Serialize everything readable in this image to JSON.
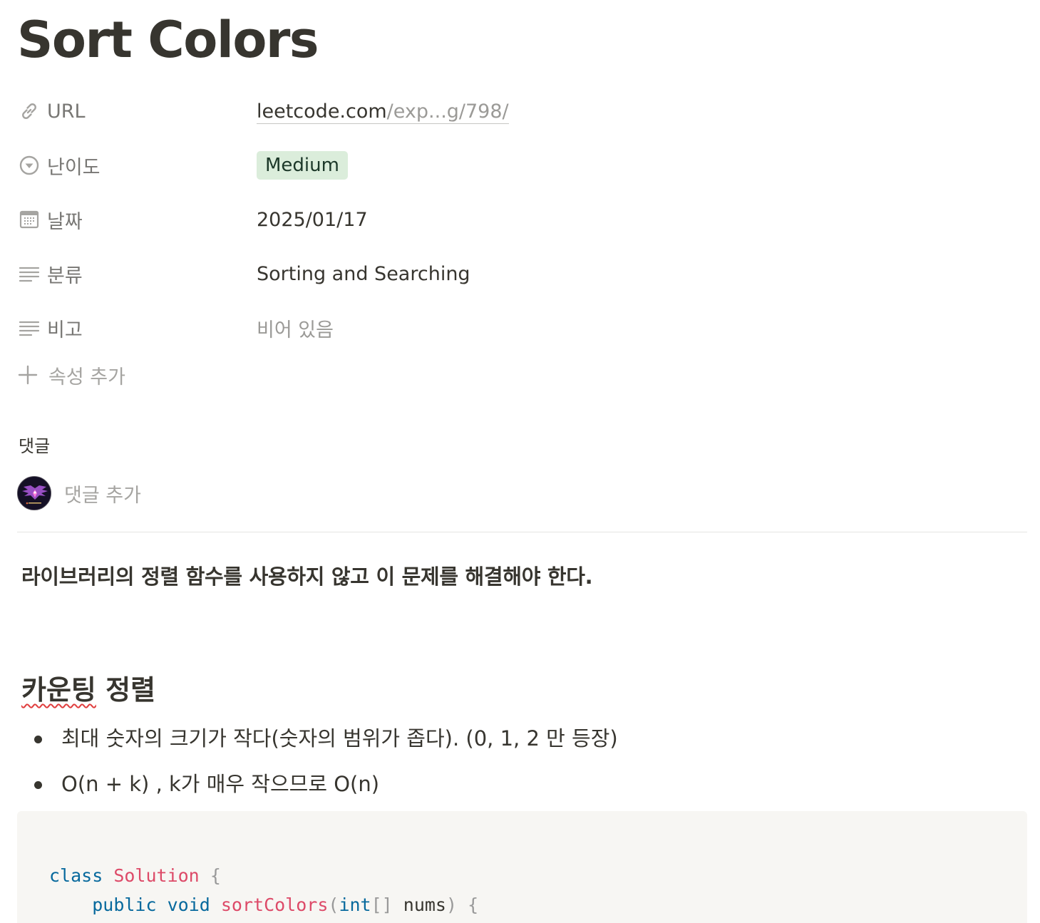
{
  "page": {
    "title": "Sort Colors"
  },
  "properties": {
    "url": {
      "label": "URL",
      "icon": "link-icon",
      "value_main": "leetcode.com",
      "value_rest": "/exp...g/798/"
    },
    "difficulty": {
      "label": "난이도",
      "icon": "select-icon",
      "value": "Medium",
      "color": "#dbeddb"
    },
    "date": {
      "label": "날짜",
      "icon": "calendar-icon",
      "value": "2025/01/17"
    },
    "category": {
      "label": "분류",
      "icon": "text-icon",
      "value": "Sorting and Searching"
    },
    "note": {
      "label": "비고",
      "icon": "text-icon",
      "value": "비어 있음"
    },
    "add_property": "속성 추가"
  },
  "comments": {
    "heading": "댓글",
    "placeholder": "댓글 추가"
  },
  "content": {
    "bold_paragraph": "라이브러리의 정렬 함수를 사용하지 않고 이 문제를 해결해야 한다.",
    "heading_misspelled": "카운팅",
    "heading_rest": " 정렬",
    "bullets": [
      "최대 숫자의 크기가 작다(숫자의 범위가 좁다). (0, 1, 2 만 등장)",
      "O(n + k) , k가 매우 작으므로 O(n)"
    ]
  },
  "code": {
    "line1": {
      "kw": "class",
      "name": "Solution",
      "brace": "{"
    },
    "line2": {
      "kw1": "public",
      "kw2": "void",
      "fn": "sortColors",
      "open": "(",
      "type": "int",
      "brackets": "[]",
      "param": " nums",
      "close": ")",
      "brace": "{"
    }
  }
}
